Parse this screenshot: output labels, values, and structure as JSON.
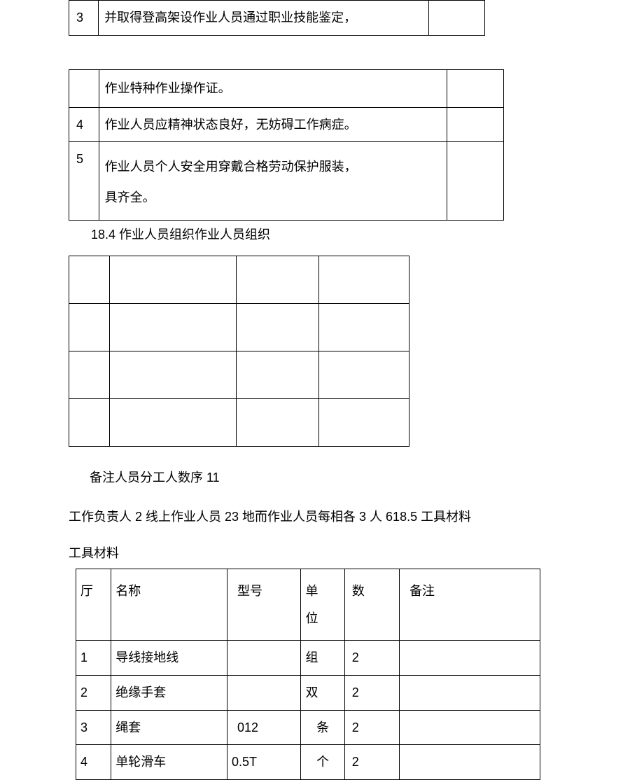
{
  "table1": {
    "rows": [
      {
        "num": "3",
        "text": "并取得登高架设作业人员通过职业技能鉴定，",
        "check": ""
      }
    ]
  },
  "table2": {
    "rows": [
      {
        "num": "",
        "text": "作业特种作业操作证。",
        "check": ""
      },
      {
        "num": "4",
        "text": "作业人员应精神状态良好，无妨碍工作病症。",
        "check": ""
      },
      {
        "num": "5",
        "text": "作业人员个人安全用穿戴合格劳动保护服装，\n具齐全。",
        "check": ""
      }
    ]
  },
  "heading184": "18.4 作业人员组织作业人员组织",
  "note_line": "备注人员分工人数序 11",
  "para_line": "工作负责人 2 线上作业人员 23 地而作业人员每相各 3 人 618.5 工具材料",
  "tools_heading": "工具材料",
  "table4": {
    "headers": {
      "c1": "厅",
      "c2": "名称",
      "c3": "型号",
      "c4": "单\n位",
      "c5": "数",
      "c6": "备注"
    },
    "rows": [
      {
        "c1": "1",
        "c2": "导线接地线",
        "c3": "",
        "c4": "组",
        "c5": "2",
        "c6": ""
      },
      {
        "c1": "2",
        "c2": "绝缘手套",
        "c3": "",
        "c4": "双",
        "c5": "2",
        "c6": ""
      },
      {
        "c1": "3",
        "c2": "绳套",
        "c3": "012",
        "c4": "条",
        "c5": "2",
        "c6": ""
      },
      {
        "c1": "4",
        "c2": "单轮滑车",
        "c3": "0.5T",
        "c4": "个",
        "c5": "2",
        "c6": ""
      }
    ]
  }
}
